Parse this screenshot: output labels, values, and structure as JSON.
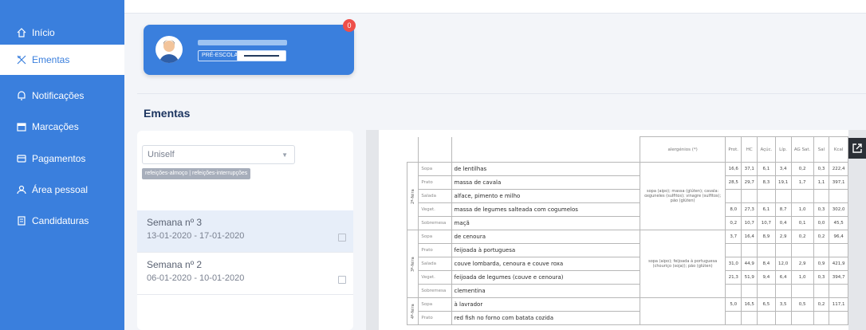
{
  "sidebar": {
    "items": [
      {
        "label": "Início",
        "icon": "home-icon"
      },
      {
        "label": "Ementas",
        "icon": "utensils-icon"
      },
      {
        "label": "Notificações",
        "icon": "bell-icon"
      },
      {
        "label": "Marcações",
        "icon": "calendar-icon"
      },
      {
        "label": "Pagamentos",
        "icon": "wallet-icon"
      },
      {
        "label": "Área pessoal",
        "icon": "user-icon"
      },
      {
        "label": "Candidaturas",
        "icon": "document-icon"
      }
    ],
    "active": "Ementas"
  },
  "profile": {
    "level": "PRÉ-ESCOLAR",
    "notification_count": "0"
  },
  "page": {
    "title": "Ementas"
  },
  "filters": {
    "provider": "Uniself",
    "tags": "refeições-almoço | refeições-interrupções"
  },
  "weeks": [
    {
      "title": "Semana nº 3",
      "dates": "13-01-2020 - 17-01-2020"
    },
    {
      "title": "Semana nº 2",
      "dates": "06-01-2020 - 10-01-2020"
    }
  ],
  "menu_doc": {
    "headers": {
      "allergens": "alergénios (*)",
      "cols": [
        "Prot.",
        "HC",
        "Açúc.",
        "Líp.",
        "AG Sat.",
        "Sal",
        "Kcal"
      ]
    },
    "days": [
      {
        "day": "2ª-feira",
        "allergens": "sopa (aipo); massa (glúten); cavala: oxguneles (sulfitos); vinagre (sulfitos); pão (glúten)",
        "rows": [
          {
            "type": "Sopa",
            "dish": "de lentilhas",
            "n": [
              "16,6",
              "37,1",
              "6,1",
              "3,4",
              "0,2",
              "0,3",
              "222,4"
            ]
          },
          {
            "type": "Prato",
            "dish": "massa de cavala",
            "n": [
              "28,5",
              "29,7",
              "8,3",
              "19,1",
              "1,7",
              "1,1",
              "397,1"
            ]
          },
          {
            "type": "Salada",
            "dish": "alface, pimento e milho",
            "n": [
              "",
              "",
              "",
              "",
              "",
              "",
              ""
            ]
          },
          {
            "type": "Veget.",
            "dish": "massa de legumes salteada com cogumelos",
            "n": [
              "8,0",
              "27,3",
              "6,1",
              "8,7",
              "1,0",
              "0,3",
              "302,0"
            ]
          },
          {
            "type": "Sobremesa",
            "dish": "maçã",
            "n": [
              "0,2",
              "10,7",
              "10,7",
              "0,4",
              "0,1",
              "0,0",
              "45,5"
            ]
          }
        ]
      },
      {
        "day": "3ª-feira",
        "allergens": "sopa (aipo); feijoada à portuguesa (chouriço (soja)); pão (glúten)",
        "rows": [
          {
            "type": "Sopa",
            "dish": "de cenoura",
            "n": [
              "3,7",
              "16,4",
              "8,9",
              "2,9",
              "0,2",
              "0,2",
              "96,4"
            ]
          },
          {
            "type": "Prato",
            "dish": "feijoada à portuguesa",
            "n": [
              "",
              "",
              "",
              "",
              "",
              "",
              ""
            ]
          },
          {
            "type": "Salada",
            "dish": "couve lombarda, cenoura e couve roxa",
            "n": [
              "31,0",
              "44,9",
              "8,4",
              "12,0",
              "2,9",
              "0,9",
              "421,9"
            ]
          },
          {
            "type": "Veget.",
            "dish": "feijoada de legumes (couve e cenoura)",
            "n": [
              "21,3",
              "51,9",
              "9,4",
              "6,4",
              "1,0",
              "0,3",
              "394,7"
            ]
          },
          {
            "type": "Sobremesa",
            "dish": "clementina",
            "n": [
              "",
              "",
              "",
              "",
              "",
              "",
              ""
            ]
          }
        ]
      },
      {
        "day": "4ª-feira",
        "allergens": "",
        "rows": [
          {
            "type": "Sopa",
            "dish": "à lavrador",
            "n": [
              "5,0",
              "16,5",
              "6,5",
              "3,5",
              "0,5",
              "0,2",
              "117,1"
            ]
          },
          {
            "type": "Prato",
            "dish": "red fish no forno com batata cozida",
            "n": [
              "",
              "",
              "",
              "",
              "",
              "",
              ""
            ]
          }
        ]
      }
    ]
  }
}
